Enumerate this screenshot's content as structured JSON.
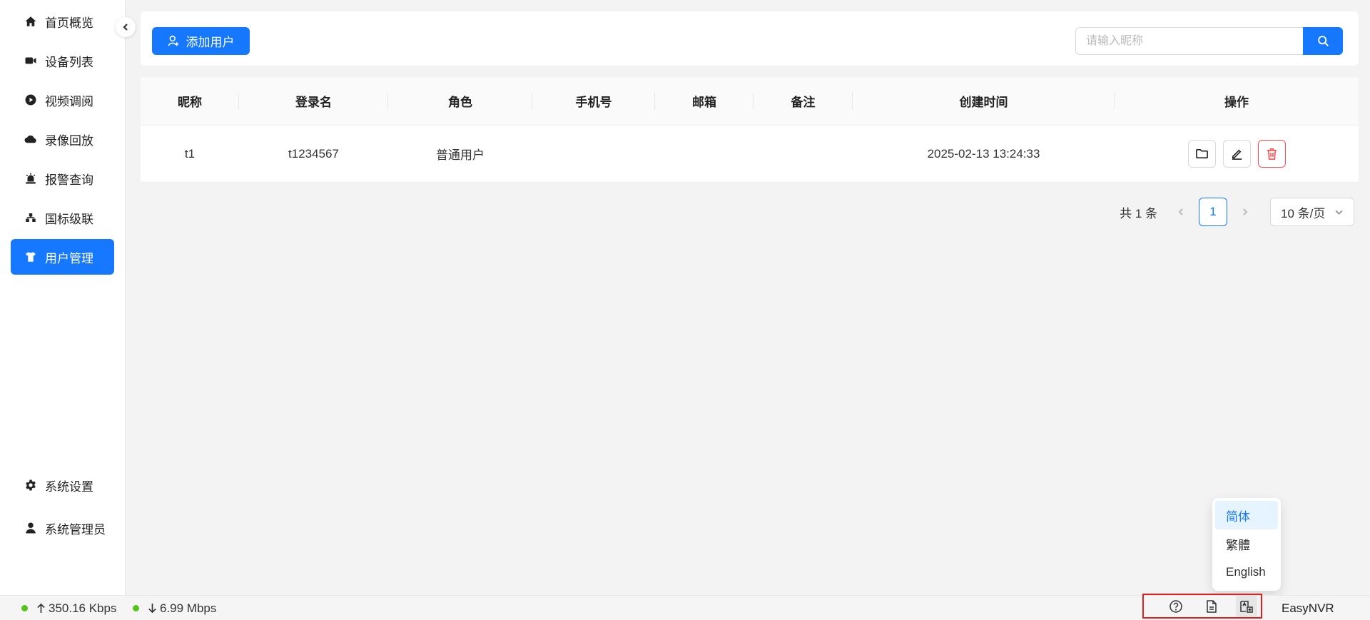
{
  "sidebar": {
    "items": [
      {
        "label": "首页概览",
        "icon": "home-icon"
      },
      {
        "label": "设备列表",
        "icon": "camera-icon"
      },
      {
        "label": "视频调阅",
        "icon": "play-circle-icon"
      },
      {
        "label": "录像回放",
        "icon": "cloud-icon"
      },
      {
        "label": "报警查询",
        "icon": "alarm-icon"
      },
      {
        "label": "国标级联",
        "icon": "cascade-icon"
      },
      {
        "label": "用户管理",
        "icon": "shirt-icon",
        "active": true
      }
    ],
    "bottom": [
      {
        "label": "系统设置",
        "icon": "gear-icon"
      },
      {
        "label": "系统管理员",
        "icon": "user-icon"
      }
    ]
  },
  "toolbar": {
    "add_label": "添加用户",
    "search_placeholder": "请输入昵称"
  },
  "table": {
    "columns": [
      "昵称",
      "登录名",
      "角色",
      "手机号",
      "邮箱",
      "备注",
      "创建时间",
      "操作"
    ],
    "rows": [
      {
        "nickname": "t1",
        "login": "t1234567",
        "role": "普通用户",
        "phone": "",
        "email": "",
        "remark": "",
        "created": "2025-02-13 13:24:33"
      }
    ]
  },
  "pagination": {
    "total": "共 1 条",
    "current": "1",
    "page_size": "10 条/页"
  },
  "statusbar": {
    "upload": "350.16 Kbps",
    "download": "6.99 Mbps",
    "brand": "EasyNVR",
    "status_color": "#52c41a"
  },
  "language_menu": {
    "items": [
      "简体",
      "繁體",
      "English"
    ],
    "selected": "简体"
  },
  "colors": {
    "accent": "#1677ff",
    "danger": "#ff4d4f",
    "highlight_border": "#e02020"
  }
}
